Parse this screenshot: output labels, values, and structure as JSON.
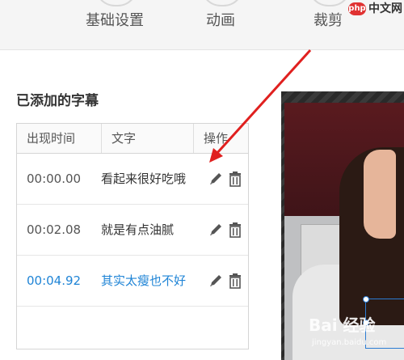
{
  "tabs": [
    {
      "label": "基础设置"
    },
    {
      "label": "动画"
    },
    {
      "label": "裁剪"
    }
  ],
  "watermark_top": {
    "badge": "php",
    "text": "中文网"
  },
  "subtitles": {
    "title": "已添加的字幕",
    "headers": {
      "time": "出现时间",
      "text": "文字",
      "actions": "操作"
    },
    "rows": [
      {
        "time": "00:00.00",
        "text": "看起来很好吃哦"
      },
      {
        "time": "00:02.08",
        "text": "就是有点油腻"
      },
      {
        "time": "00:04.92",
        "text": "其实太瘦也不好"
      }
    ]
  },
  "preview": {
    "watermark": "Bai 经验",
    "url": "jingyan.baidu.com"
  },
  "colors": {
    "accent": "#1f84d6",
    "arrow": "#e0201f"
  }
}
